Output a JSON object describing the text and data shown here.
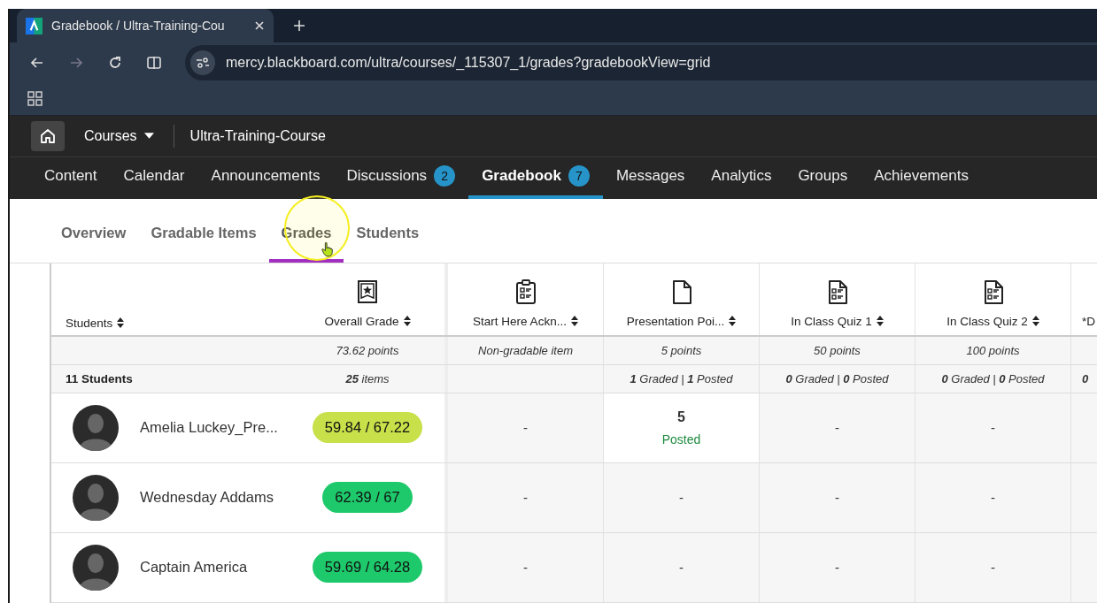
{
  "browser": {
    "tab_title": "Gradebook / Ultra-Training-Cou",
    "url": "mercy.blackboard.com/ultra/courses/_115307_1/grades?gradebookView=grid"
  },
  "course_header": {
    "courses_label": "Courses",
    "course_name": "Ultra-Training-Course"
  },
  "course_nav": [
    {
      "label": "Content",
      "selected": false
    },
    {
      "label": "Calendar",
      "selected": false
    },
    {
      "label": "Announcements",
      "selected": false
    },
    {
      "label": "Discussions",
      "selected": false,
      "badge": "2"
    },
    {
      "label": "Gradebook",
      "selected": true,
      "badge": "7"
    },
    {
      "label": "Messages",
      "selected": false
    },
    {
      "label": "Analytics",
      "selected": false
    },
    {
      "label": "Groups",
      "selected": false
    },
    {
      "label": "Achievements",
      "selected": false
    }
  ],
  "subtabs": [
    {
      "label": "Overview",
      "selected": false
    },
    {
      "label": "Gradable Items",
      "selected": false
    },
    {
      "label": "Grades",
      "selected": true
    },
    {
      "label": "Students",
      "selected": false
    }
  ],
  "grid": {
    "students_heading": "Students",
    "student_count": "**11** Students",
    "columns": [
      {
        "kind": "overall",
        "title": "Overall Grade",
        "points": "73.62 points",
        "summary": "**25** items"
      },
      {
        "kind": "survey",
        "title": "Start Here Ackn...",
        "points": "Non-gradable item"
      },
      {
        "kind": "document",
        "title": "Presentation Poi...",
        "points": "5 points",
        "summary": "**1** Graded | **1** Posted"
      },
      {
        "kind": "test",
        "title": "In Class Quiz 1",
        "points": "50 points",
        "summary": "**0** Graded | **0** Posted"
      },
      {
        "kind": "test",
        "title": "In Class Quiz 2",
        "points": "100 points",
        "summary": "**0** Graded | **0** Posted"
      },
      {
        "kind": "partial",
        "title": "*D",
        "summary": "**0**"
      }
    ],
    "rows": [
      {
        "name": "Amelia Luckey_Pre...",
        "cells": [
          {
            "kind": "pill",
            "value": "59.84 / 67.22",
            "color": "#c8e04a"
          },
          {
            "kind": "text",
            "value": "-"
          },
          {
            "kind": "graded",
            "value": "5",
            "status": "Posted"
          },
          {
            "kind": "text",
            "value": "-"
          },
          {
            "kind": "text",
            "value": "-"
          },
          {
            "kind": "empty"
          }
        ]
      },
      {
        "name": "Wednesday Addams",
        "cells": [
          {
            "kind": "pill",
            "value": "62.39 / 67",
            "color": "#1ec96b"
          },
          {
            "kind": "text",
            "value": "-"
          },
          {
            "kind": "text",
            "value": "-"
          },
          {
            "kind": "text",
            "value": "-"
          },
          {
            "kind": "text",
            "value": "-"
          },
          {
            "kind": "empty"
          }
        ]
      },
      {
        "name": "Captain America",
        "cells": [
          {
            "kind": "pill",
            "value": "59.69 / 64.28",
            "color": "#1ec96b"
          },
          {
            "kind": "text",
            "value": "-"
          },
          {
            "kind": "text",
            "value": "-"
          },
          {
            "kind": "text",
            "value": "-"
          },
          {
            "kind": "text",
            "value": "-"
          },
          {
            "kind": "empty"
          }
        ]
      }
    ]
  }
}
